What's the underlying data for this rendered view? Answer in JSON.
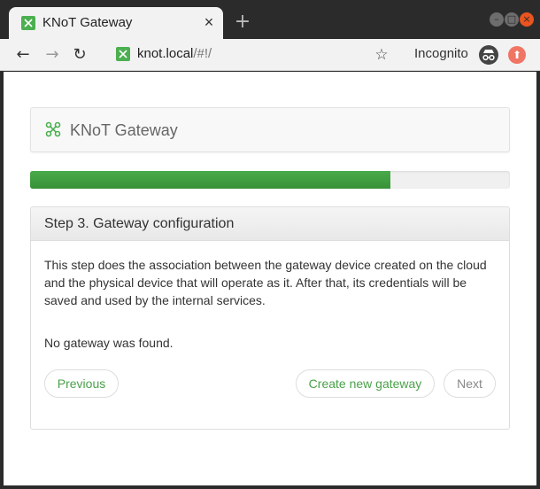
{
  "browser": {
    "tab_title": "KNoT Gateway",
    "tab_close": "×",
    "new_tab": "+",
    "url_host": "knot.local",
    "url_path": "/#!/",
    "incognito_label": "Incognito"
  },
  "page": {
    "header_title": "KNoT Gateway",
    "progress": 0.75,
    "panel_title": "Step 3. Gateway configuration",
    "panel_description": "This step does the association between the gateway device created on the cloud and the physical device that will operate as it. After that, its credentials will be saved and used by the internal services.",
    "status_text": "No gateway was found.",
    "buttons": {
      "previous": "Previous",
      "create": "Create new gateway",
      "next": "Next"
    }
  },
  "colors": {
    "accent_green": "#4aa14a",
    "progress_fill": "#3e9e3e"
  }
}
